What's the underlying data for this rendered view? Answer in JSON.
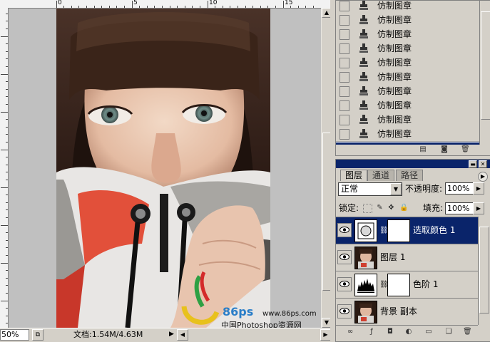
{
  "document": {
    "ruler_numbers": [
      "0",
      "5",
      "10",
      "15"
    ],
    "zoom": "50%",
    "doc_info": "文档:1.54M/4.63M",
    "watermark": {
      "brand": "86ps",
      "url": "www.86ps.com",
      "site": "中国Photoshop资源网"
    }
  },
  "history": {
    "items": [
      {
        "label": "仿制图章",
        "icon": "clone-stamp-icon"
      },
      {
        "label": "仿制图章",
        "icon": "clone-stamp-icon"
      },
      {
        "label": "仿制图章",
        "icon": "clone-stamp-icon"
      },
      {
        "label": "仿制图章",
        "icon": "clone-stamp-icon"
      },
      {
        "label": "仿制图章",
        "icon": "clone-stamp-icon"
      },
      {
        "label": "仿制图章",
        "icon": "clone-stamp-icon"
      },
      {
        "label": "仿制图章",
        "icon": "clone-stamp-icon"
      },
      {
        "label": "仿制图章",
        "icon": "clone-stamp-icon"
      },
      {
        "label": "仿制图章",
        "icon": "clone-stamp-icon"
      },
      {
        "label": "仿制图章",
        "icon": "clone-stamp-icon"
      }
    ]
  },
  "layers_panel": {
    "tabs": [
      "图层",
      "通道",
      "路径"
    ],
    "active_tab": "图层",
    "blend_mode": "正常",
    "opacity_label": "不透明度:",
    "opacity": "100%",
    "lock_label": "锁定:",
    "fill_label": "填充:",
    "fill": "100%",
    "layers": [
      {
        "name": "选取颜色 1",
        "type": "adjustment-selective-color",
        "selected": true,
        "has_mask": true
      },
      {
        "name": "图层 1",
        "type": "pixel",
        "selected": false,
        "has_mask": false
      },
      {
        "name": "色阶 1",
        "type": "adjustment-levels",
        "selected": false,
        "has_mask": true
      },
      {
        "name": "背景 副本",
        "type": "pixel",
        "selected": false,
        "has_mask": false
      }
    ]
  },
  "colors": {
    "selection": "#0a246a",
    "panel_bg": "#d4d0c8",
    "canvas_bg": "#c0c0c0"
  }
}
